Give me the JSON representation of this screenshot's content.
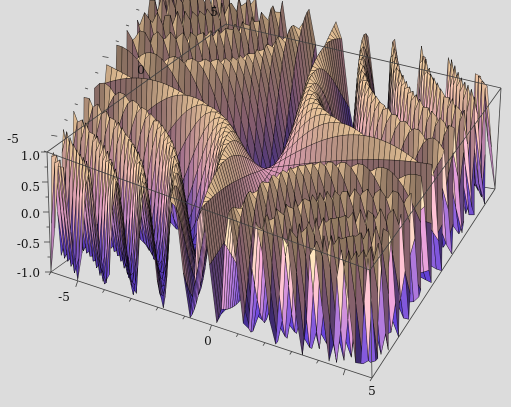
{
  "chart_data": {
    "type": "surface3d",
    "function": "sin(x*y)",
    "title": "",
    "xlabel": "",
    "ylabel": "",
    "zlabel": "",
    "x_range": [
      -6,
      6
    ],
    "y_range": [
      -6,
      6
    ],
    "z_range": [
      -1,
      1
    ],
    "x_ticks": [
      "-5",
      "0",
      "5"
    ],
    "y_ticks": [
      "-5",
      "0",
      "5"
    ],
    "z_ticks": [
      "1.0",
      "0.5",
      "0.0",
      "-0.5",
      "-1.0"
    ],
    "colors": {
      "background": "#dcdcdc",
      "high": "#ffd7a8",
      "mid": "#f0a8c8",
      "low": "#5a3cc8",
      "mesh": "#000000",
      "box": "#404040"
    }
  }
}
